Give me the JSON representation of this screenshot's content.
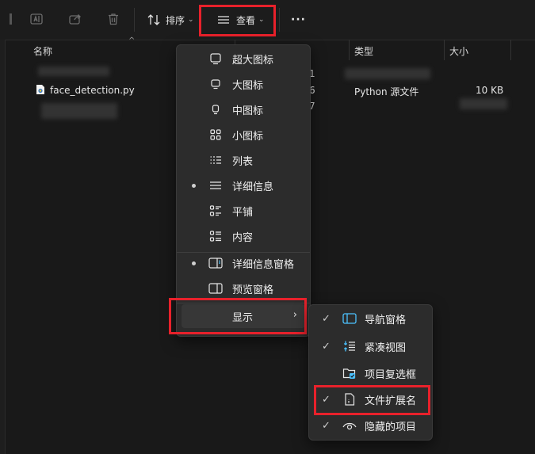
{
  "toolbar": {
    "sort_label": "排序",
    "view_label": "查看",
    "more_label": "···"
  },
  "columns": {
    "name": "名称",
    "type": "类型",
    "size": "大小"
  },
  "files": [
    {
      "name": "face_detection.py",
      "date_fragment": "6",
      "type": "Python 源文件",
      "size": "10 KB"
    }
  ],
  "date_fragments": [
    "1",
    "7"
  ],
  "view_menu": {
    "items": [
      {
        "label": "超大图标",
        "icon": "extra-large-icons-icon",
        "selected": false
      },
      {
        "label": "大图标",
        "icon": "large-icons-icon",
        "selected": false
      },
      {
        "label": "中图标",
        "icon": "medium-icons-icon",
        "selected": false
      },
      {
        "label": "小图标",
        "icon": "small-icons-icon",
        "selected": false
      },
      {
        "label": "列表",
        "icon": "list-icon",
        "selected": false
      },
      {
        "label": "详细信息",
        "icon": "details-icon",
        "selected": true
      },
      {
        "label": "平铺",
        "icon": "tiles-icon",
        "selected": false
      },
      {
        "label": "内容",
        "icon": "content-icon",
        "selected": false
      }
    ],
    "pane_items": [
      {
        "label": "详细信息窗格",
        "icon": "details-pane-icon",
        "selected": true
      },
      {
        "label": "预览窗格",
        "icon": "preview-pane-icon",
        "selected": false
      }
    ],
    "show_label": "显示"
  },
  "show_submenu": {
    "items": [
      {
        "label": "导航窗格",
        "icon": "navigation-pane-icon",
        "checked": true
      },
      {
        "label": "紧凑视图",
        "icon": "compact-view-icon",
        "checked": true
      },
      {
        "label": "项目复选框",
        "icon": "item-checkbox-icon",
        "checked": false
      },
      {
        "label": "文件扩展名",
        "icon": "file-extension-icon",
        "checked": true
      },
      {
        "label": "隐藏的项目",
        "icon": "hidden-items-icon",
        "checked": true
      }
    ]
  },
  "colors": {
    "accent": "#4cc2ff",
    "highlight": "#e8212b"
  }
}
